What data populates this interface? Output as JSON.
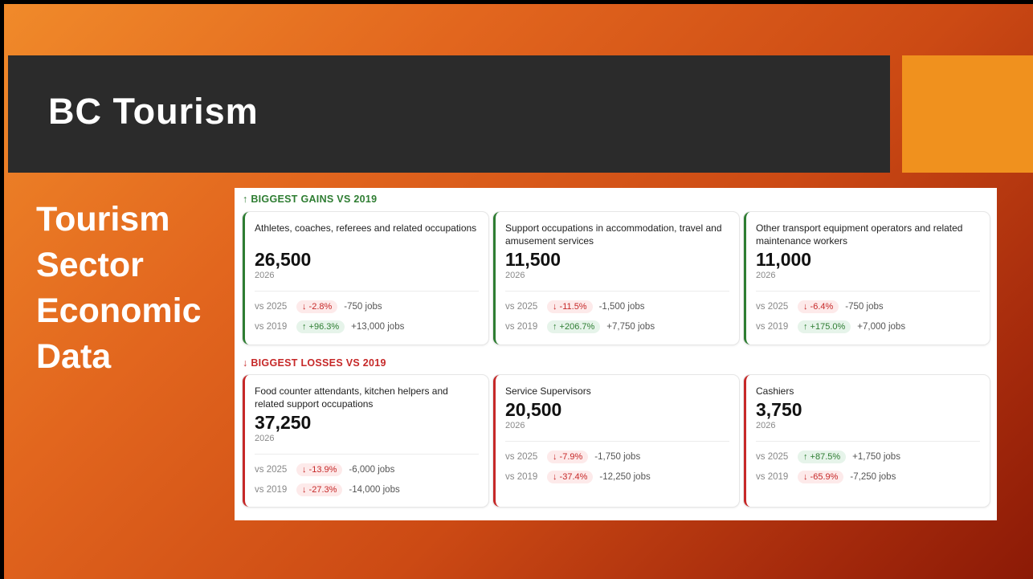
{
  "slide": {
    "title": "BC Tourism",
    "side_lines": [
      "Tourism",
      "Sector",
      "Economic",
      "Data"
    ]
  },
  "gains": {
    "header": "↑ BIGGEST GAINS VS 2019",
    "cards": [
      {
        "occupation": "Athletes, coaches, referees and related occupations",
        "value": "26,500",
        "year": "2026",
        "rows": [
          {
            "label": "vs 2025",
            "pct": "↓ -2.8%",
            "dir": "down",
            "jobs": "-750 jobs"
          },
          {
            "label": "vs 2019",
            "pct": "↑ +96.3%",
            "dir": "up",
            "jobs": "+13,000 jobs"
          }
        ]
      },
      {
        "occupation": "Support occupations in accommodation, travel and amusement services",
        "value": "11,500",
        "year": "2026",
        "rows": [
          {
            "label": "vs 2025",
            "pct": "↓ -11.5%",
            "dir": "down",
            "jobs": "-1,500 jobs"
          },
          {
            "label": "vs 2019",
            "pct": "↑ +206.7%",
            "dir": "up",
            "jobs": "+7,750 jobs"
          }
        ]
      },
      {
        "occupation": "Other transport equipment operators and related maintenance workers",
        "value": "11,000",
        "year": "2026",
        "rows": [
          {
            "label": "vs 2025",
            "pct": "↓ -6.4%",
            "dir": "down",
            "jobs": "-750 jobs"
          },
          {
            "label": "vs 2019",
            "pct": "↑ +175.0%",
            "dir": "up",
            "jobs": "+7,000 jobs"
          }
        ]
      }
    ]
  },
  "losses": {
    "header": "↓ BIGGEST LOSSES VS 2019",
    "cards": [
      {
        "occupation": "Food counter attendants, kitchen helpers and related support occupations",
        "value": "37,250",
        "year": "2026",
        "rows": [
          {
            "label": "vs 2025",
            "pct": "↓ -13.9%",
            "dir": "down",
            "jobs": "-6,000 jobs"
          },
          {
            "label": "vs 2019",
            "pct": "↓ -27.3%",
            "dir": "down",
            "jobs": "-14,000 jobs"
          }
        ]
      },
      {
        "occupation": "Service Supervisors",
        "value": "20,500",
        "year": "2026",
        "rows": [
          {
            "label": "vs 2025",
            "pct": "↓ -7.9%",
            "dir": "down",
            "jobs": "-1,750 jobs"
          },
          {
            "label": "vs 2019",
            "pct": "↓ -37.4%",
            "dir": "down",
            "jobs": "-12,250 jobs"
          }
        ]
      },
      {
        "occupation": "Cashiers",
        "value": "3,750",
        "year": "2026",
        "rows": [
          {
            "label": "vs 2025",
            "pct": "↑ +87.5%",
            "dir": "up",
            "jobs": "+1,750 jobs"
          },
          {
            "label": "vs 2019",
            "pct": "↓ -65.9%",
            "dir": "down",
            "jobs": "-7,250 jobs"
          }
        ]
      }
    ]
  }
}
